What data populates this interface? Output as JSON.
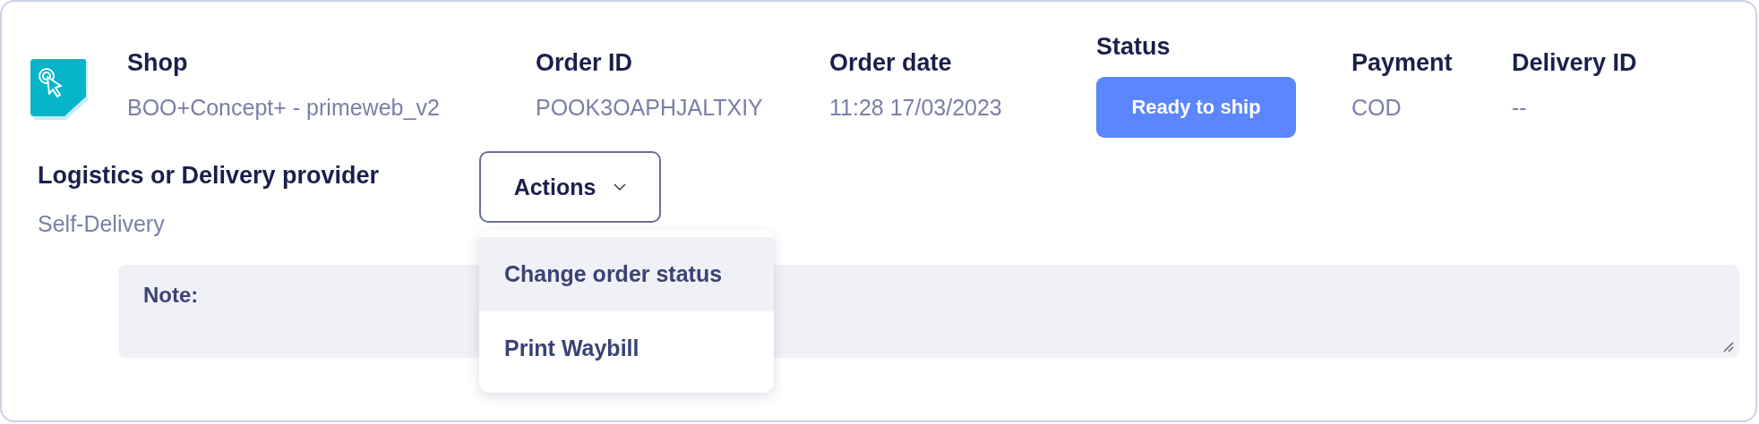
{
  "fields": [
    {
      "label": "Shop",
      "value": "BOO+Concept+ - primeweb_v2",
      "kind": "text"
    },
    {
      "label": "Order ID",
      "value": "POOK3OAPHJALTXIY",
      "kind": "text"
    },
    {
      "label": "Order date",
      "value": "11:28 17/03/2023",
      "kind": "text"
    },
    {
      "label": "Status",
      "value": "Ready to ship",
      "kind": "badge"
    },
    {
      "label": "Payment",
      "value": "COD",
      "kind": "text"
    },
    {
      "label": "Delivery ID",
      "value": "--",
      "kind": "text"
    }
  ],
  "logistics": {
    "label": "Logistics or Delivery provider",
    "value": "Self-Delivery"
  },
  "actions": {
    "label": "Actions",
    "expanded": true,
    "items": [
      {
        "label": "Change order status",
        "selected": true
      },
      {
        "label": "Print Waybill",
        "selected": false
      }
    ]
  },
  "note": {
    "label": "Note:"
  }
}
